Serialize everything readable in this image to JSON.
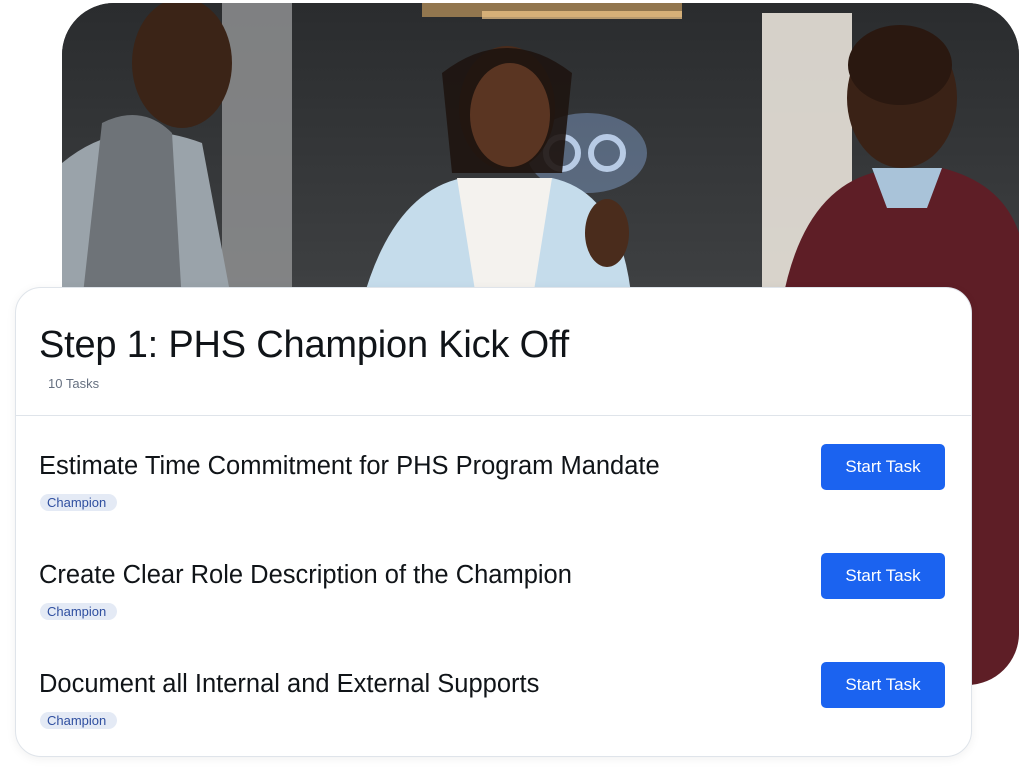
{
  "card": {
    "title": "Step 1: PHS Champion Kick Off",
    "subtitle": "10 Tasks"
  },
  "tasks": [
    {
      "title": "Estimate Time Commitment for PHS Program Mandate",
      "tag": "Champion",
      "button_label": "Start Task"
    },
    {
      "title": "Create Clear Role Description of the Champion",
      "tag": "Champion",
      "button_label": "Start Task"
    },
    {
      "title": "Document all Internal and External Supports",
      "tag": "Champion",
      "button_label": "Start Task"
    }
  ],
  "colors": {
    "button": "#1b63f0",
    "tag_background": "#e4eaf5",
    "tag_text": "#2f4fa0",
    "jacket_light_blue": "#c5dceb",
    "sweater_maroon": "#5e1e26"
  }
}
